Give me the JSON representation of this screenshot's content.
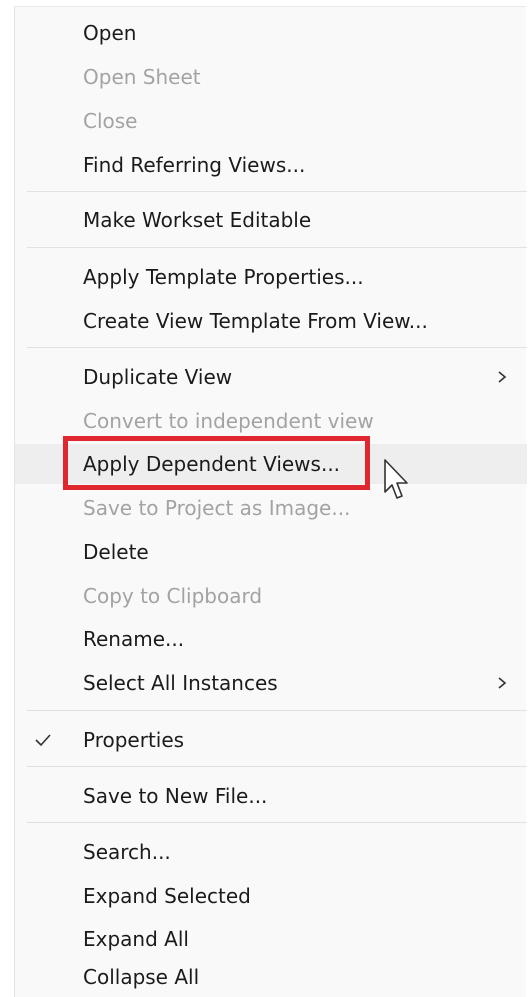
{
  "menu": {
    "items": [
      {
        "label": "Open",
        "enabled": true
      },
      {
        "label": "Open Sheet",
        "enabled": false
      },
      {
        "label": "Close",
        "enabled": false
      },
      {
        "label": "Find Referring Views...",
        "enabled": true
      },
      {
        "label": "Make Workset Editable",
        "enabled": true
      },
      {
        "label": "Apply Template Properties...",
        "enabled": true
      },
      {
        "label": "Create View Template From View...",
        "enabled": true
      },
      {
        "label": "Duplicate View",
        "enabled": true,
        "submenu": true
      },
      {
        "label": "Convert to independent view",
        "enabled": false
      },
      {
        "label": "Apply Dependent Views...",
        "enabled": true,
        "highlighted": true
      },
      {
        "label": "Save to Project as Image...",
        "enabled": false
      },
      {
        "label": "Delete",
        "enabled": true
      },
      {
        "label": "Copy to Clipboard",
        "enabled": false
      },
      {
        "label": "Rename...",
        "enabled": true
      },
      {
        "label": "Select All Instances",
        "enabled": true,
        "submenu": true
      },
      {
        "label": "Properties",
        "enabled": true,
        "checked": true
      },
      {
        "label": "Save to New File...",
        "enabled": true
      },
      {
        "label": "Search...",
        "enabled": true
      },
      {
        "label": "Expand Selected",
        "enabled": true
      },
      {
        "label": "Expand All",
        "enabled": true
      },
      {
        "label": "Collapse All",
        "enabled": true
      }
    ]
  },
  "icons": {
    "submenu": "chevron-right-icon",
    "checked": "checkmark-icon",
    "pointer": "mouse-pointer-icon"
  },
  "colors": {
    "menu_background": "#f9f9f9",
    "text": "#1b1b1b",
    "disabled_text": "#a3a3a3",
    "separator": "#e2e2e2",
    "hover_background": "#eeeeee",
    "highlight_border": "#e0262e"
  }
}
